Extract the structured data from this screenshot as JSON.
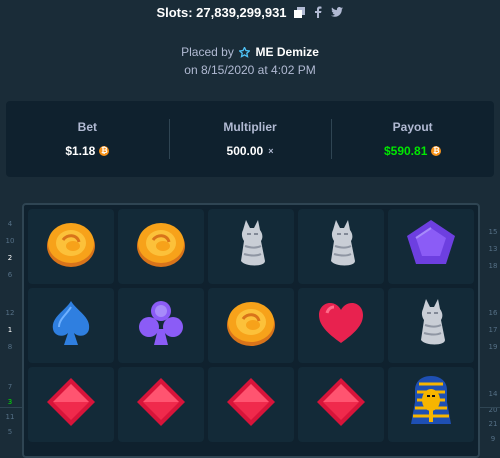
{
  "header": {
    "title": "Slots: 27,839,299,931",
    "placed_by_label": "Placed by",
    "username": "ME Demize",
    "timestamp": "on 8/15/2020 at 4:02 PM"
  },
  "stats": {
    "bet_label": "Bet",
    "bet_value": "$1.18",
    "multiplier_label": "Multiplier",
    "multiplier_value": "500.00",
    "multiplier_suffix": "×",
    "payout_label": "Payout",
    "payout_value": "$590.81"
  },
  "reels": {
    "rows": [
      [
        "coin",
        "coin",
        "cat",
        "cat",
        "pentagon-gem"
      ],
      [
        "spade",
        "club",
        "coin",
        "heart",
        "cat"
      ],
      [
        "diamond",
        "diamond",
        "diamond",
        "diamond",
        "pharaoh"
      ]
    ]
  },
  "left_gutter": [
    "4",
    "10",
    "2",
    "6",
    "12",
    "1",
    "8",
    "7",
    "3",
    "11",
    "5"
  ],
  "right_gutter": [
    "15",
    "13",
    "18",
    "16",
    "17",
    "19",
    "14",
    "20",
    "21",
    "9"
  ],
  "colors": {
    "background": "#1a2c38",
    "panel": "#0f212e",
    "payout_green": "#00e701",
    "coin_orange": "#f7931a"
  }
}
